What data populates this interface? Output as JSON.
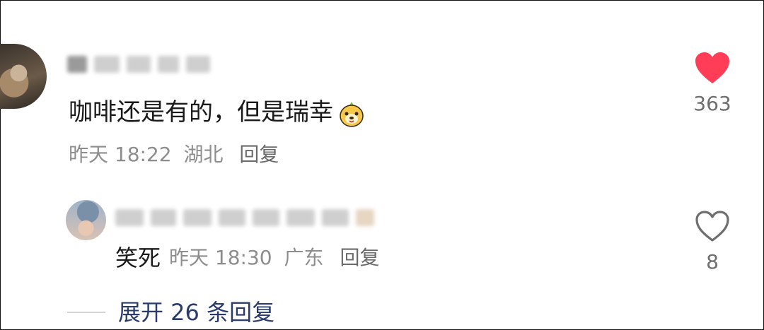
{
  "colors": {
    "liked_heart": "#ff3d57",
    "unliked_heart": "#6e6e6e",
    "expand_link": "#2a3b6b",
    "meta_gray": "#8d8d8d"
  },
  "comment": {
    "avatar_icon": "cat-avatar",
    "text": "咖啡还是有的，但是瑞幸",
    "emoji_icon": "bear-sticker-icon",
    "timestamp": "昨天 18:22",
    "location": "湖北",
    "reply_label": "回复",
    "liked": true,
    "like_count": "363"
  },
  "reply": {
    "avatar_icon": "person-avatar",
    "text": "笑死",
    "timestamp": "昨天 18:30",
    "location": "广东",
    "reply_label": "回复",
    "liked": false,
    "like_count": "8"
  },
  "expand_replies": {
    "label": "展开 26 条回复"
  }
}
